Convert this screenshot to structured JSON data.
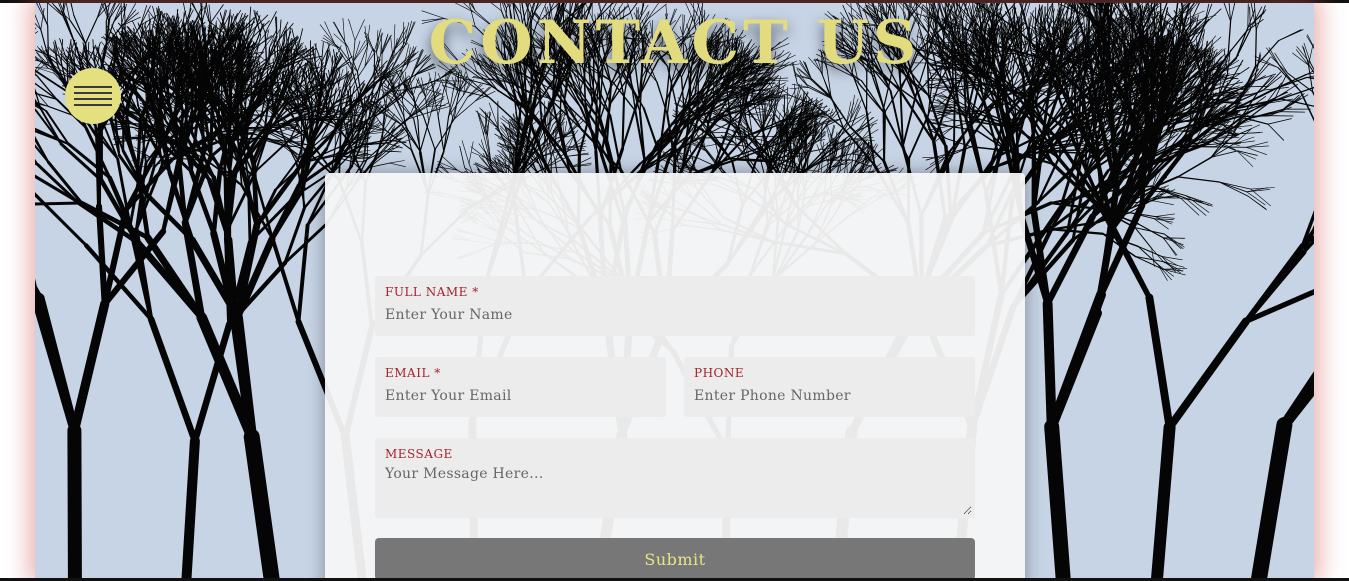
{
  "page": {
    "title": "CONTACT US"
  },
  "nav": {
    "menu_icon": "hamburger-menu-icon"
  },
  "form": {
    "full_name": {
      "label": "FULL NAME *",
      "placeholder": "Enter Your Name",
      "value": ""
    },
    "email": {
      "label": "EMAIL *",
      "placeholder": "Enter Your Email",
      "value": ""
    },
    "phone": {
      "label": "PHONE",
      "placeholder": "Enter Phone Number",
      "value": ""
    },
    "message": {
      "label": "MESSAGE",
      "placeholder": "Your Message Here...",
      "value": ""
    },
    "submit_label": "Submit"
  },
  "colors": {
    "title": "#e2dc7e",
    "menu_button": "#e4df7f",
    "label": "#a3242c",
    "submit_bg": "#777777",
    "submit_text": "#e8e486",
    "sky": "#c6d4e6"
  }
}
